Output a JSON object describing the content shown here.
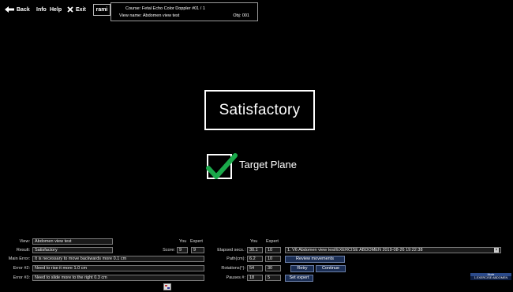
{
  "toolbar": {
    "back_label": "Back",
    "info_label": "Info",
    "help_label": "Help",
    "exit_label": "Exit",
    "user": "rami"
  },
  "course_info": {
    "course": "Course: Fetal Echo Color Doppler #01 / 1",
    "view_name": "View name: Abdomen view test",
    "obj": "Obj: 001"
  },
  "result": {
    "title": "Satisfactory",
    "target_label": "Target Plane",
    "target_checked": true
  },
  "panel": {
    "left": {
      "view_label": "View:",
      "view_value": "Abdomen view test",
      "result_label": "Result:",
      "result_value": "Satisfactory",
      "main_error_label": "Main Error:",
      "main_error_value": "It is necessary to move backwards more 0.1 cm",
      "error2_label": "Error #2:",
      "error2_value": "Need to rise it more 1.0 cm",
      "error3_label": "Error #3:",
      "error3_value": "Need to slide more to the right 0.3 cm"
    },
    "score": {
      "you_header": "You",
      "expert_header": "Expert",
      "label": "Score:",
      "you": "9",
      "expert": "9"
    },
    "stats": {
      "you_header": "You",
      "expert_header": "Expert",
      "elapsed_label": "Elapsed secs.:",
      "elapsed_you": "30.1",
      "elapsed_expert": "10",
      "path_label": "Path(cm):",
      "path_you": "6.2",
      "path_expert": "10",
      "rotations_label": "Rotations(°):",
      "rotations_you": "54",
      "rotations_expert": "30",
      "pauses_label": "Pauses #:",
      "pauses_you": "18",
      "pauses_expert": "5"
    },
    "right": {
      "record": "1. V6 Abdomen view test/EXERCISE ABDOMEN 2019-08-26 19:22:38",
      "review_label": "Review movements",
      "retry_label": "Retry",
      "continue_label": "Continue",
      "set_expert_label": "Set expert"
    },
    "mode": {
      "header": "Mode",
      "value": "1.EXERCISE ABDOMEN"
    }
  }
}
